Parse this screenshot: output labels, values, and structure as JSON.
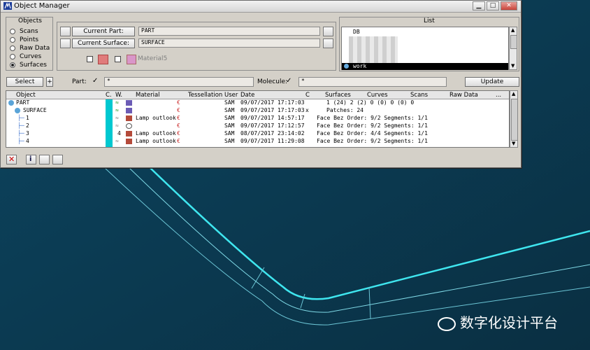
{
  "window": {
    "title": "Object Manager"
  },
  "objects_panel": {
    "title": "Objects",
    "options": [
      "Scans",
      "Points",
      "Raw Data",
      "Curves",
      "Surfaces"
    ],
    "selected": "Surfaces"
  },
  "current": {
    "part_label": "Current Part:",
    "part_value": "PART",
    "surface_label": "Current Surface:",
    "surface_value": "SURFACE",
    "material_value": "Material5"
  },
  "list_panel": {
    "title": "List",
    "items": [
      "DB",
      "work"
    ],
    "selected": "work"
  },
  "filter_bar": {
    "select_label": "Select",
    "plus_label": "+",
    "part_label": "Part:",
    "part_filter": "*",
    "molecule_label": "Molecule:",
    "molecule_filter": "*",
    "update_label": "Update"
  },
  "table": {
    "columns": [
      "Object",
      "C.",
      "W.",
      "Material",
      "Tessellation",
      "User",
      "Date",
      "C",
      "Surfaces",
      "Curves",
      "Scans",
      "Raw Data",
      "..."
    ],
    "rows": [
      {
        "object": "PART",
        "material": "",
        "user": "SAM",
        "date": "09/07/2017 17:17:03",
        "c": "",
        "info": "  1  (24)      2   (2)      0   (0)      0  (0)      0"
      },
      {
        "object": "SURFACE",
        "material": "",
        "user": "SAM",
        "date": "09/07/2017 17:17:03",
        "c": "x",
        "info": "     Patches: 24"
      },
      {
        "object": "1",
        "material": "Lamp outlook",
        "user": "SAM",
        "date": "09/07/2017 14:57:17",
        "c": "",
        "info": "Face  Bez    Order: 9/2  Segments: 1/1"
      },
      {
        "object": "2",
        "material": "",
        "user": "SAM",
        "date": "09/07/2017 17:12:57",
        "c": "",
        "info": "Face  Bez    Order: 9/2  Segments: 1/1"
      },
      {
        "object": "3",
        "material": "Lamp outlook",
        "user": "SAM",
        "date": "08/07/2017 23:14:02",
        "c": "",
        "info": "Face  Bez    Order: 4/4  Segments: 1/1"
      },
      {
        "object": "4",
        "material": "Lamp outlook",
        "user": "SAM",
        "date": "09/07/2017 11:29:08",
        "c": "",
        "info": "Face  Bez    Order: 9/2  Segments: 1/1"
      }
    ],
    "w_number": "4"
  },
  "watermark": {
    "text": "数字化设计平台"
  },
  "colors": {
    "accent_teal": "#00c8d0",
    "list_highlight": "#000000",
    "background": "#0b3a50",
    "curve": "#3fe6ef"
  }
}
